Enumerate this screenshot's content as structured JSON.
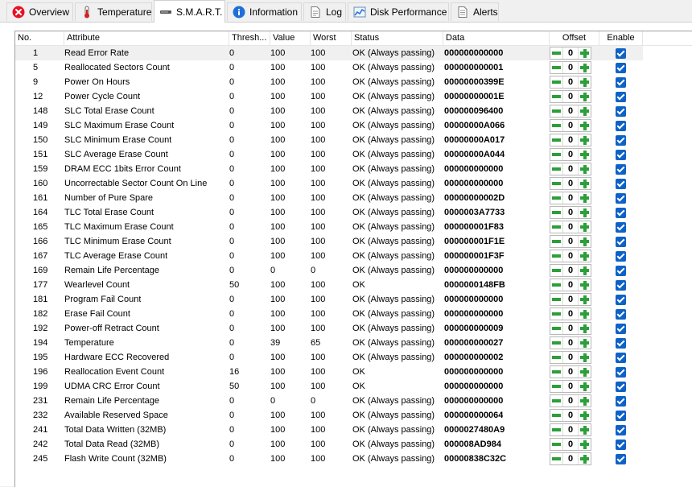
{
  "tabs": [
    {
      "label": "Overview",
      "icon": "error-icon"
    },
    {
      "label": "Temperature",
      "icon": "thermometer-icon"
    },
    {
      "label": "S.M.A.R.T.",
      "icon": "drive-icon",
      "active": true
    },
    {
      "label": "Information",
      "icon": "info-icon"
    },
    {
      "label": "Log",
      "icon": "log-icon"
    },
    {
      "label": "Disk Performance",
      "icon": "chart-icon"
    },
    {
      "label": "Alerts",
      "icon": "alerts-icon"
    }
  ],
  "columns": {
    "no": "No.",
    "attribute": "Attribute",
    "threshold": "Thresh...",
    "value": "Value",
    "worst": "Worst",
    "status": "Status",
    "data": "Data",
    "offset": "Offset",
    "enable": "Enable"
  },
  "colors": {
    "accent": "#0e62c7",
    "stepper": "#2c9f3a"
  },
  "rows": [
    {
      "no": "1",
      "attribute": "Read Error Rate",
      "threshold": "0",
      "value": "100",
      "worst": "100",
      "status": "OK (Always passing)",
      "data": "000000000000",
      "offset": "0",
      "enabled": true
    },
    {
      "no": "5",
      "attribute": "Reallocated Sectors Count",
      "threshold": "0",
      "value": "100",
      "worst": "100",
      "status": "OK (Always passing)",
      "data": "000000000001",
      "offset": "0",
      "enabled": true
    },
    {
      "no": "9",
      "attribute": "Power On Hours",
      "threshold": "0",
      "value": "100",
      "worst": "100",
      "status": "OK (Always passing)",
      "data": "00000000399E",
      "offset": "0",
      "enabled": true
    },
    {
      "no": "12",
      "attribute": "Power Cycle Count",
      "threshold": "0",
      "value": "100",
      "worst": "100",
      "status": "OK (Always passing)",
      "data": "00000000001E",
      "offset": "0",
      "enabled": true
    },
    {
      "no": "148",
      "attribute": "SLC Total Erase Count",
      "threshold": "0",
      "value": "100",
      "worst": "100",
      "status": "OK (Always passing)",
      "data": "000000096400",
      "offset": "0",
      "enabled": true
    },
    {
      "no": "149",
      "attribute": "SLC Maximum Erase Count",
      "threshold": "0",
      "value": "100",
      "worst": "100",
      "status": "OK (Always passing)",
      "data": "00000000A066",
      "offset": "0",
      "enabled": true
    },
    {
      "no": "150",
      "attribute": "SLC Minimum Erase Count",
      "threshold": "0",
      "value": "100",
      "worst": "100",
      "status": "OK (Always passing)",
      "data": "00000000A017",
      "offset": "0",
      "enabled": true
    },
    {
      "no": "151",
      "attribute": "SLC Average Erase Count",
      "threshold": "0",
      "value": "100",
      "worst": "100",
      "status": "OK (Always passing)",
      "data": "00000000A044",
      "offset": "0",
      "enabled": true
    },
    {
      "no": "159",
      "attribute": "DRAM ECC 1bits Error Count",
      "threshold": "0",
      "value": "100",
      "worst": "100",
      "status": "OK (Always passing)",
      "data": "000000000000",
      "offset": "0",
      "enabled": true
    },
    {
      "no": "160",
      "attribute": "Uncorrectable Sector Count On Line",
      "threshold": "0",
      "value": "100",
      "worst": "100",
      "status": "OK (Always passing)",
      "data": "000000000000",
      "offset": "0",
      "enabled": true
    },
    {
      "no": "161",
      "attribute": "Number of Pure Spare",
      "threshold": "0",
      "value": "100",
      "worst": "100",
      "status": "OK (Always passing)",
      "data": "00000000002D",
      "offset": "0",
      "enabled": true
    },
    {
      "no": "164",
      "attribute": "TLC Total Erase Count",
      "threshold": "0",
      "value": "100",
      "worst": "100",
      "status": "OK (Always passing)",
      "data": "0000003A7733",
      "offset": "0",
      "enabled": true
    },
    {
      "no": "165",
      "attribute": "TLC Maximum Erase Count",
      "threshold": "0",
      "value": "100",
      "worst": "100",
      "status": "OK (Always passing)",
      "data": "000000001F83",
      "offset": "0",
      "enabled": true
    },
    {
      "no": "166",
      "attribute": "TLC Minimum Erase Count",
      "threshold": "0",
      "value": "100",
      "worst": "100",
      "status": "OK (Always passing)",
      "data": "000000001F1E",
      "offset": "0",
      "enabled": true
    },
    {
      "no": "167",
      "attribute": "TLC Average Erase Count",
      "threshold": "0",
      "value": "100",
      "worst": "100",
      "status": "OK (Always passing)",
      "data": "000000001F3F",
      "offset": "0",
      "enabled": true
    },
    {
      "no": "169",
      "attribute": "Remain Life Percentage",
      "threshold": "0",
      "value": "0",
      "worst": "0",
      "status": "OK (Always passing)",
      "data": "000000000000",
      "offset": "0",
      "enabled": true
    },
    {
      "no": "177",
      "attribute": "Wearlevel Count",
      "threshold": "50",
      "value": "100",
      "worst": "100",
      "status": "OK",
      "data": "0000000148FB",
      "offset": "0",
      "enabled": true
    },
    {
      "no": "181",
      "attribute": "Program Fail Count",
      "threshold": "0",
      "value": "100",
      "worst": "100",
      "status": "OK (Always passing)",
      "data": "000000000000",
      "offset": "0",
      "enabled": true
    },
    {
      "no": "182",
      "attribute": "Erase Fail Count",
      "threshold": "0",
      "value": "100",
      "worst": "100",
      "status": "OK (Always passing)",
      "data": "000000000000",
      "offset": "0",
      "enabled": true
    },
    {
      "no": "192",
      "attribute": "Power-off Retract Count",
      "threshold": "0",
      "value": "100",
      "worst": "100",
      "status": "OK (Always passing)",
      "data": "000000000009",
      "offset": "0",
      "enabled": true
    },
    {
      "no": "194",
      "attribute": "Temperature",
      "threshold": "0",
      "value": "39",
      "worst": "65",
      "status": "OK (Always passing)",
      "data": "000000000027",
      "offset": "0",
      "enabled": true
    },
    {
      "no": "195",
      "attribute": "Hardware ECC Recovered",
      "threshold": "0",
      "value": "100",
      "worst": "100",
      "status": "OK (Always passing)",
      "data": "000000000002",
      "offset": "0",
      "enabled": true
    },
    {
      "no": "196",
      "attribute": "Reallocation Event Count",
      "threshold": "16",
      "value": "100",
      "worst": "100",
      "status": "OK",
      "data": "000000000000",
      "offset": "0",
      "enabled": true
    },
    {
      "no": "199",
      "attribute": "UDMA CRC Error Count",
      "threshold": "50",
      "value": "100",
      "worst": "100",
      "status": "OK",
      "data": "000000000000",
      "offset": "0",
      "enabled": true
    },
    {
      "no": "231",
      "attribute": "Remain Life Percentage",
      "threshold": "0",
      "value": "0",
      "worst": "0",
      "status": "OK (Always passing)",
      "data": "000000000000",
      "offset": "0",
      "enabled": true
    },
    {
      "no": "232",
      "attribute": "Available Reserved Space",
      "threshold": "0",
      "value": "100",
      "worst": "100",
      "status": "OK (Always passing)",
      "data": "000000000064",
      "offset": "0",
      "enabled": true
    },
    {
      "no": "241",
      "attribute": "Total Data Written (32MB)",
      "threshold": "0",
      "value": "100",
      "worst": "100",
      "status": "OK (Always passing)",
      "data": "0000027480A9",
      "offset": "0",
      "enabled": true
    },
    {
      "no": "242",
      "attribute": "Total Data Read (32MB)",
      "threshold": "0",
      "value": "100",
      "worst": "100",
      "status": "OK (Always passing)",
      "data": "000008AD984",
      "offset": "0",
      "enabled": true
    },
    {
      "no": "245",
      "attribute": "Flash Write Count (32MB)",
      "threshold": "0",
      "value": "100",
      "worst": "100",
      "status": "OK (Always passing)",
      "data": "00000838C32C",
      "offset": "0",
      "enabled": true
    }
  ]
}
